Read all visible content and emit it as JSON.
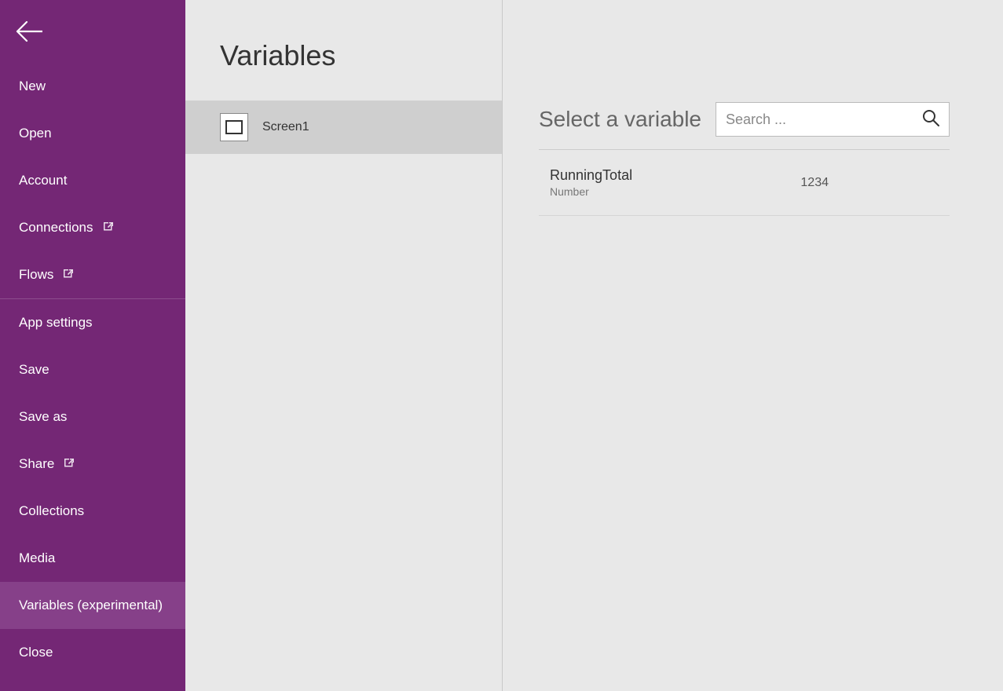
{
  "sidebar": {
    "items": [
      {
        "label": "New"
      },
      {
        "label": "Open"
      },
      {
        "label": "Account"
      },
      {
        "label": "Connections",
        "ext": true
      },
      {
        "label": "Flows",
        "ext": true
      },
      {
        "label": "App settings"
      },
      {
        "label": "Save"
      },
      {
        "label": "Save as"
      },
      {
        "label": "Share",
        "ext": true
      },
      {
        "label": "Collections"
      },
      {
        "label": "Media"
      },
      {
        "label": "Variables (experimental)",
        "selected": true
      },
      {
        "label": "Close"
      }
    ]
  },
  "mid": {
    "title": "Variables",
    "screen_label": "Screen1"
  },
  "right": {
    "title": "Select a variable",
    "search_placeholder": "Search ...",
    "variables": [
      {
        "name": "RunningTotal",
        "type": "Number",
        "value": "1234"
      }
    ]
  }
}
